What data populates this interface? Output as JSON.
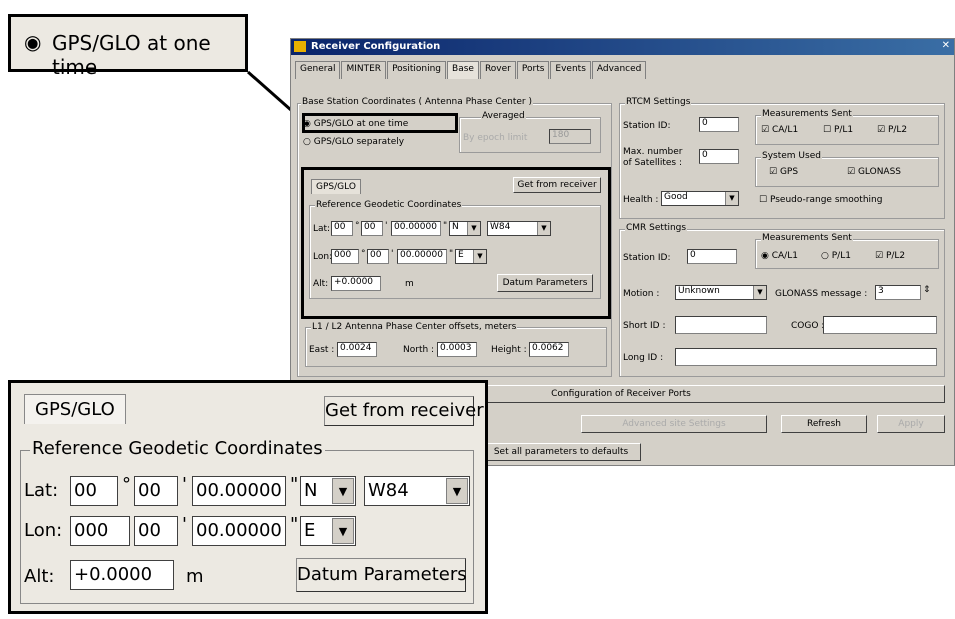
{
  "callout_top": {
    "radio_label": "GPS/GLO at one time"
  },
  "window": {
    "title": "Receiver Configuration",
    "close": "✕",
    "tabs": [
      "General",
      "MINTER",
      "Positioning",
      "Base",
      "Rover",
      "Ports",
      "Events",
      "Advanced"
    ]
  },
  "base_coords": {
    "group_label": "Base Station Coordinates ( Antenna Phase Center )",
    "radio1": "GPS/GLO at one time",
    "radio2": "GPS/GLO separately",
    "averaged_label": "Averaged",
    "count_label": "By epoch limit",
    "count_value": "180"
  },
  "inner": {
    "tab_label": "GPS/GLO",
    "get_button": "Get from receiver",
    "ref_group": "Reference Geodetic Coordinates",
    "lat_label": "Lat:",
    "lat_deg": "00",
    "lat_min": "00",
    "lat_sec": "00.00000",
    "lat_dir": "N",
    "datum": "W84",
    "lon_label": "Lon:",
    "lon_deg": "000",
    "lon_min": "00",
    "lon_sec": "00.00000",
    "lon_dir": "E",
    "alt_label": "Alt:",
    "alt_value": "+0.0000",
    "alt_unit": "m",
    "datum_button": "Datum Parameters",
    "deg_sym": "°",
    "min_sym": "'",
    "sec_sym": "\""
  },
  "offsets": {
    "group_label": "L1 / L2 Antenna Phase Center offsets, meters",
    "east_label": "East :",
    "east_value": "0.0024",
    "north_label": "North :",
    "north_value": "0.0003",
    "height_label": "Height :",
    "height_value": "0.0062"
  },
  "rtcm": {
    "group_label": "RTCM Settings",
    "station_label": "Station ID:",
    "station_value": "0",
    "maxsat_label1": "Max. number",
    "maxsat_label2": "of Satellites :",
    "maxsat_value": "0",
    "health_label": "Health :",
    "health_value": "Good",
    "meas_label": "Measurements Sent",
    "ca": "CA/L1",
    "p1": "P/L1",
    "p2": "P/L2",
    "sys_label": "System Used",
    "gps": "GPS",
    "glonass": "GLONASS",
    "pseudo": "Pseudo-range smoothing"
  },
  "cmr": {
    "group_label": "CMR Settings",
    "station_label": "Station ID:",
    "station_value": "0",
    "meas_label": "Measurements Sent",
    "ca": "CA/L1",
    "p1": "P/L1",
    "p2": "P/L2",
    "motion_label": "Motion :",
    "motion_value": "Unknown",
    "glo_msg_label": "GLONASS message :",
    "glo_msg_value": "3",
    "short_label": "Short ID :",
    "cogo_label": "COGO :",
    "long_label": "Long ID :"
  },
  "bottom": {
    "config_ports": "Configuration of Receiver Ports",
    "adv_settings": "Advanced site Settings",
    "refresh": "Refresh",
    "apply": "Apply",
    "reset": "Set all parameters to defaults"
  },
  "zoom": {
    "tab_label": "GPS/GLO",
    "get_button": "Get from receiver",
    "ref_group": "Reference Geodetic Coordinates",
    "lat_label": "Lat:",
    "lat_deg": "00",
    "lat_min": "00",
    "lat_sec": "00.00000",
    "lat_dir": "N",
    "datum": "W84",
    "lon_label": "Lon:",
    "lon_deg": "000",
    "lon_min": "00",
    "lon_sec": "00.00000",
    "lon_dir": "E",
    "alt_label": "Alt:",
    "alt_value": "+0.0000",
    "alt_unit": "m",
    "datum_button": "Datum Parameters"
  },
  "icons": {
    "radio_on": "◉",
    "radio_off": "○",
    "check_on": "☑",
    "check_off": "☐",
    "arrow_down": "▼",
    "spin": "⇕"
  }
}
